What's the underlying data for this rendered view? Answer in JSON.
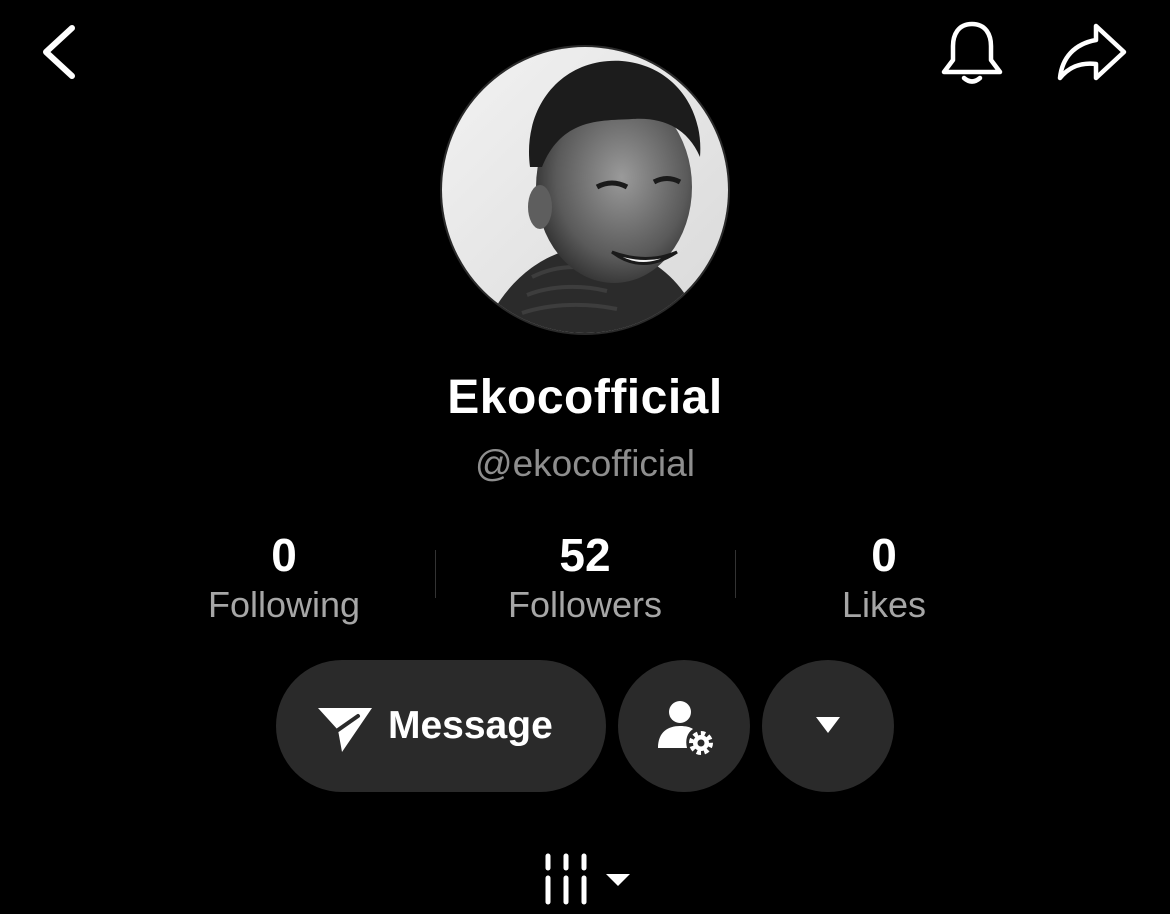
{
  "profile": {
    "display_name": "Ekocofficial",
    "handle": "@ekocofficial"
  },
  "stats": [
    {
      "value": "0",
      "label": "Following"
    },
    {
      "value": "52",
      "label": "Followers"
    },
    {
      "value": "0",
      "label": "Likes"
    }
  ],
  "actions": {
    "message_label": "Message"
  },
  "icons": {
    "back": "chevron-left-icon",
    "notifications": "bell-icon",
    "share": "share-arrow-icon",
    "message": "paper-plane-icon",
    "profile_settings": "user-gear-icon",
    "more": "caret-down-icon",
    "grid_tab": "grid-filter-icon"
  },
  "colors": {
    "background": "#000000",
    "button_bg": "#2a2a2a",
    "text_primary": "#ffffff",
    "text_secondary": "#8e8e8e"
  }
}
